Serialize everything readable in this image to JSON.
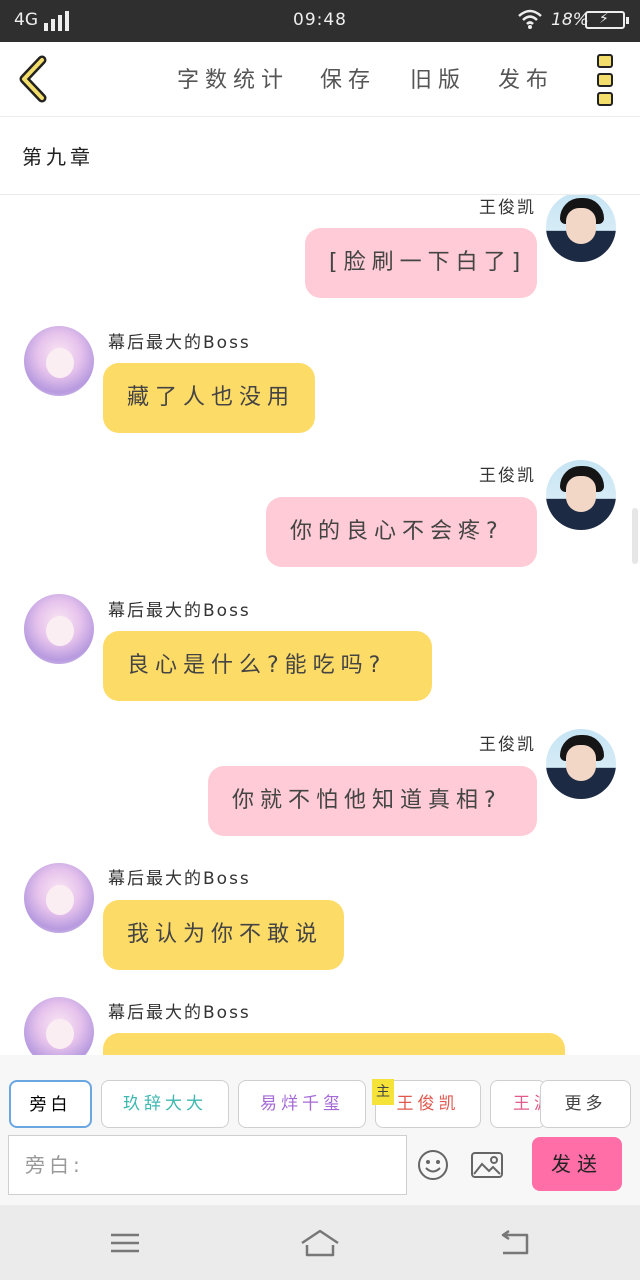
{
  "status_bar": {
    "network": "4G",
    "time": "09:48",
    "battery": "18%"
  },
  "toolbar": {
    "word_count": "字数统计",
    "save": "保存",
    "old_version": "旧版",
    "publish": "发布"
  },
  "chapter_title": "第九章",
  "messages": [
    {
      "sender": "王俊凯",
      "text": "[脸刷一下白了]",
      "side": "right"
    },
    {
      "sender": "幕后最大的Boss",
      "text": "藏了人也没用",
      "side": "left"
    },
    {
      "sender": "王俊凯",
      "text": "你的良心不会疼?",
      "side": "right"
    },
    {
      "sender": "幕后最大的Boss",
      "text": "良心是什么?能吃吗?",
      "side": "left"
    },
    {
      "sender": "王俊凯",
      "text": "你就不怕他知道真相?",
      "side": "right"
    },
    {
      "sender": "幕后最大的Boss",
      "text": "我认为你不敢说",
      "side": "left"
    },
    {
      "sender": "幕后最大的Boss",
      "text": "",
      "side": "left"
    }
  ],
  "roles": [
    {
      "label": "旁白",
      "active": true
    },
    {
      "label": "玖辞大大",
      "color": "#3fb8b0"
    },
    {
      "label": "易烊千玺",
      "color": "#a46ad6"
    },
    {
      "label": "王俊凯",
      "color": "#e0584f",
      "badge": "主"
    },
    {
      "label": "王源",
      "color": "#e05a8a"
    }
  ],
  "more_roles": "更多",
  "input": {
    "placeholder": "旁白:"
  },
  "send_label": "发送"
}
